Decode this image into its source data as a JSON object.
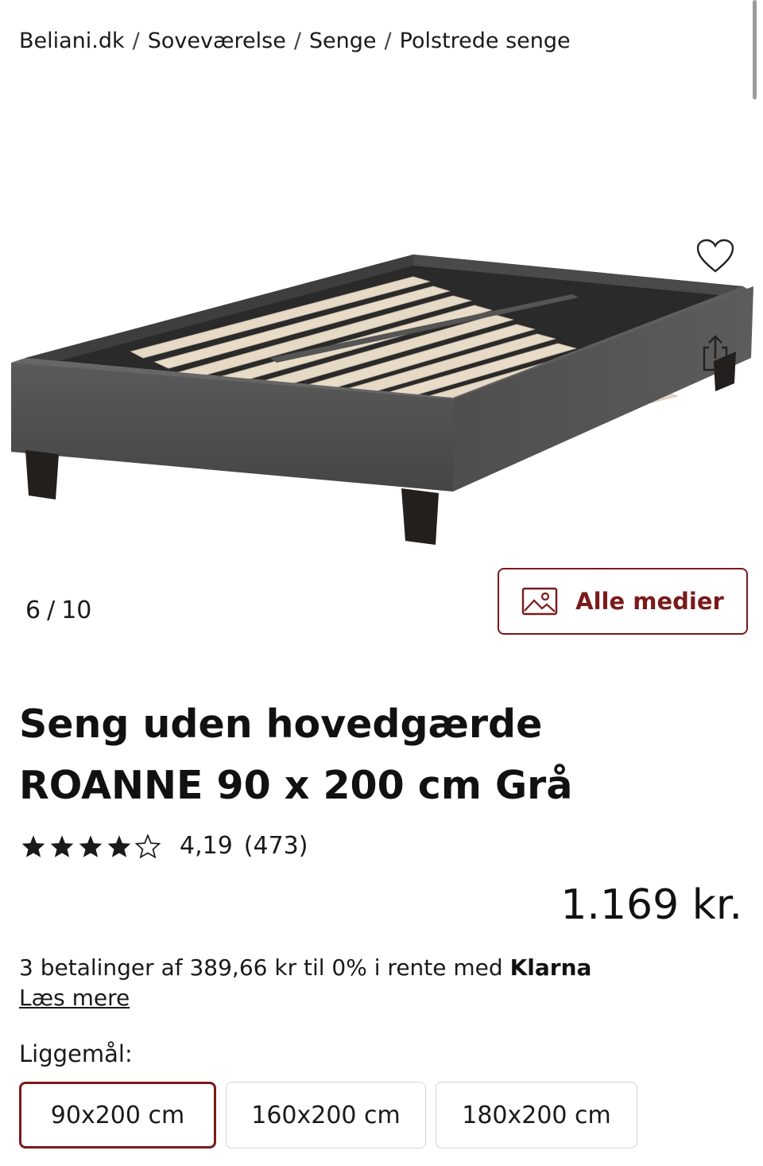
{
  "breadcrumb": {
    "items": [
      "Beliani.dk",
      "Soveværelse",
      "Senge",
      "Polstrede senge"
    ],
    "separator": "/"
  },
  "gallery": {
    "current": "6",
    "separator": "/",
    "total": "10",
    "all_media_label": "Alle medier"
  },
  "product": {
    "title_line1": "Seng uden hovedgærde",
    "title_line2": "ROANNE 90 x 200 cm Grå",
    "rating": 4.19,
    "rating_text": "4,19",
    "review_count": "(473)",
    "stars_filled": 4,
    "stars_total": 5,
    "price": "1.169 kr."
  },
  "klarna": {
    "text": "3 betalinger af 389,66 kr til 0% i rente med",
    "brand": "Klarna",
    "read_more": "Læs mere"
  },
  "size_selector": {
    "label": "Liggemål:",
    "options": [
      "90x200 cm",
      "160x200 cm",
      "180x200 cm"
    ],
    "selected_index": 0
  },
  "colors": {
    "accent": "#7a1a1a",
    "bed_fabric": "#505050",
    "slats": "#e8dcc8"
  },
  "icons": {
    "wishlist": "heart-icon",
    "share": "share-icon",
    "media": "image-icon",
    "star": "star-icon"
  }
}
